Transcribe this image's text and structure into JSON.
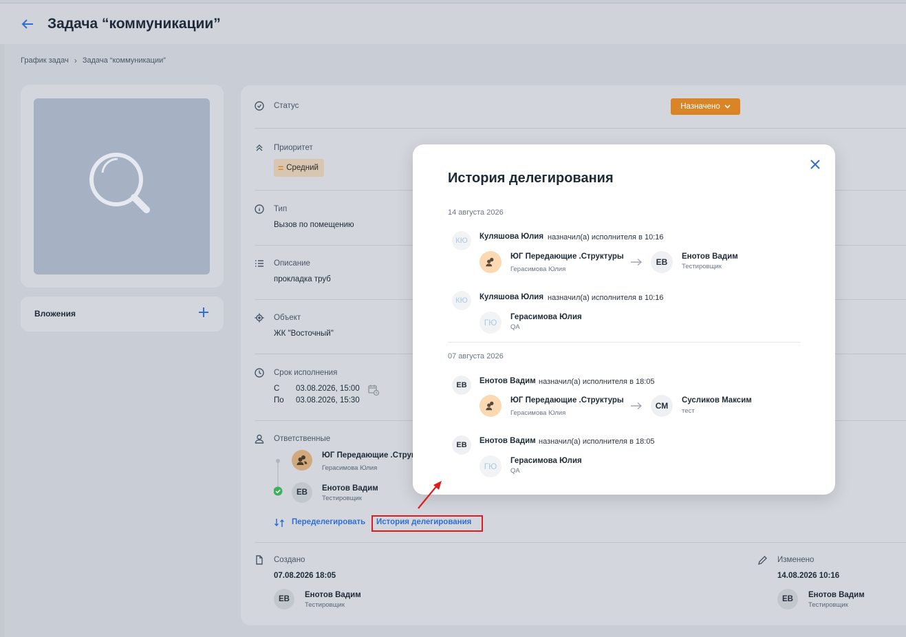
{
  "header": {
    "title": "Задача “коммуникации”"
  },
  "breadcrumb": {
    "items": [
      "График задач",
      "Задача “коммуникации”"
    ]
  },
  "attachments": {
    "label": "Вложения"
  },
  "fields": {
    "status": {
      "label": "Статус",
      "value": "Назначено"
    },
    "priority": {
      "label": "Приоритет",
      "value": "Средний"
    },
    "type": {
      "label": "Тип",
      "value": "Вызов по помещению"
    },
    "description": {
      "label": "Описание",
      "value": "прокладка труб"
    },
    "object": {
      "label": "Объект",
      "value": "ЖК \"Восточный\""
    },
    "deadline": {
      "label": "Срок исполнения",
      "from_prefix": "С",
      "from": "03.08.2026, 15:00",
      "to_prefix": "По",
      "to": "03.08.2026, 15:30"
    },
    "responsible": {
      "label": "Ответственные",
      "items": [
        {
          "avatar": "",
          "name": "ЮГ Передающие .Структуры",
          "sub": "Герасимова Юлия"
        },
        {
          "avatar": "ЕВ",
          "name": "Енотов Вадим",
          "sub": "Тестировщик"
        }
      ],
      "redelegate": "Переделегировать",
      "history": "История делегирования"
    },
    "created": {
      "label": "Создано",
      "date": "07.08.2026 18:05",
      "avatar": "ЕВ",
      "name": "Енотов Вадим",
      "sub": "Тестировщик"
    },
    "modified": {
      "label": "Изменено",
      "date": "14.08.2026 10:16",
      "avatar": "ЕВ",
      "name": "Енотов Вадим",
      "sub": "Тестировщик"
    }
  },
  "modal": {
    "title": "История делегирования",
    "groups": [
      {
        "date": "14 августа 2026",
        "entries": [
          {
            "avatar": "КЮ",
            "author": "Куляшова Юлия",
            "action": "назначил(а) исполнителя в 10:16",
            "from_name": "ЮГ Передающие .Структуры",
            "from_sub": "Герасимова Юлия",
            "to_avatar": "ЕВ",
            "to_name": "Енотов Вадим",
            "to_sub": "Тестировщик"
          },
          {
            "avatar": "КЮ",
            "author": "Куляшова Юлия",
            "action": "назначил(а) исполнителя в 10:16",
            "single_avatar": "ГЮ",
            "single_name": "Герасимова Юлия",
            "single_sub": "QA"
          }
        ]
      },
      {
        "date": "07 августа 2026",
        "entries": [
          {
            "avatar": "ЕВ",
            "author": "Енотов Вадим",
            "action": "назначил(а) исполнителя в 18:05",
            "from_name": "ЮГ Передающие .Структуры",
            "from_sub": "Герасимова Юлия",
            "to_avatar": "СМ",
            "to_name": "Сусликов Максим",
            "to_sub": "тест"
          },
          {
            "avatar": "ЕВ",
            "author": "Енотов Вадим",
            "action": "назначил(а) исполнителя в 18:05",
            "single_avatar": "ГЮ",
            "single_name": "Герасимова Юлия",
            "single_sub": "QA"
          }
        ]
      }
    ]
  },
  "colors": {
    "accent": "#2f6fd1",
    "status": "#d98526",
    "highlight": "#e01b1b"
  }
}
